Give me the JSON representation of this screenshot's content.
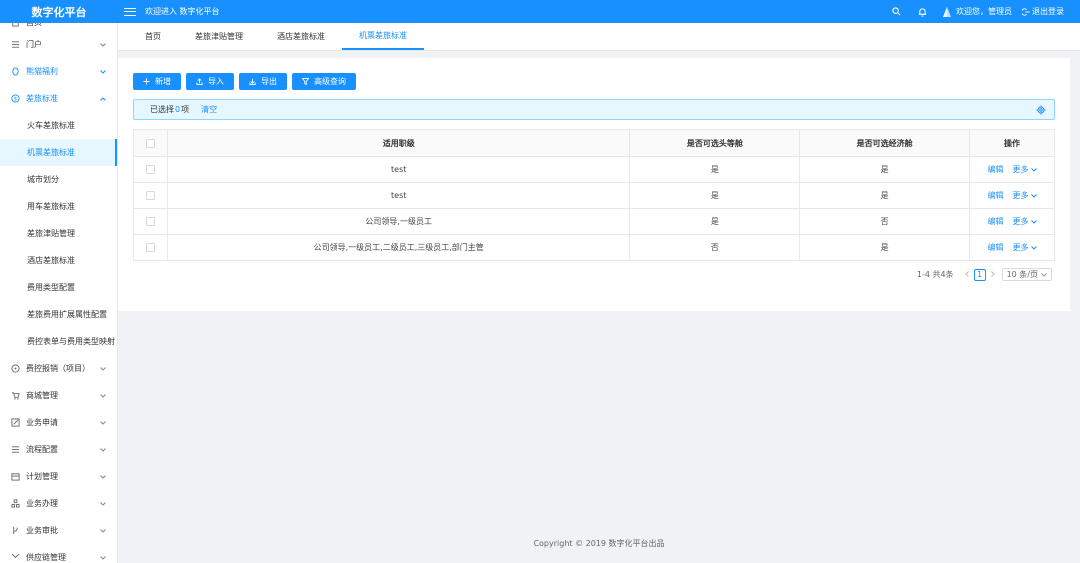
{
  "app": {
    "logo_text": "数字化平台",
    "welcome": "欢迎进入 数字化平台"
  },
  "header": {
    "greeting": "欢迎您，管理员",
    "logout": "退出登录",
    "icons": [
      "search-icon",
      "bell-icon",
      "user-avatar"
    ]
  },
  "tabs": [
    {
      "label": "首页",
      "active": false
    },
    {
      "label": "差旅津贴管理",
      "active": false
    },
    {
      "label": "酒店差旅标准",
      "active": false
    },
    {
      "label": "机票差旅标准",
      "active": true
    }
  ],
  "sidebar": {
    "items": [
      {
        "label": "首页",
        "icon": "home-icon"
      },
      {
        "label": "门户",
        "icon": "portal-icon",
        "expandable": true
      },
      {
        "label": "熊猫福利",
        "icon": "gift-icon",
        "expandable": true,
        "color": "#1890ff"
      },
      {
        "label": "差旅标准",
        "icon": "dollar-circle-icon",
        "expanded": true,
        "color": "#1890ff"
      }
    ],
    "sub_items": [
      {
        "label": "火车差旅标准"
      },
      {
        "label": "机票差旅标准",
        "selected": true
      },
      {
        "label": "城市划分"
      },
      {
        "label": "用车差旅标准"
      },
      {
        "label": "差旅津贴管理"
      },
      {
        "label": "酒店差旅标准"
      },
      {
        "label": "费用类型配置"
      },
      {
        "label": "差旅费用扩展属性配置"
      },
      {
        "label": "费控表单与费用类型映射"
      }
    ],
    "more_items": [
      {
        "label": "费控报销（项目）",
        "icon": "dollar-circle-icon"
      },
      {
        "label": "商城管理",
        "icon": "cart-icon"
      },
      {
        "label": "业务申请",
        "icon": "edit-icon"
      },
      {
        "label": "流程配置",
        "icon": "list-icon"
      },
      {
        "label": "计划管理",
        "icon": "calendar-icon"
      },
      {
        "label": "业务办理",
        "icon": "cluster-icon"
      },
      {
        "label": "业务审批",
        "icon": "branch-icon"
      },
      {
        "label": "供应链管理",
        "icon": "chain-icon"
      }
    ]
  },
  "toolbar": {
    "add": "新增",
    "import": "导入",
    "export": "导出",
    "advanced_search": "高级查询"
  },
  "selection": {
    "prefix": "已选择",
    "count": "0",
    "suffix": "项",
    "clear": "清空"
  },
  "table": {
    "columns": [
      "适用职级",
      "是否可选头等舱",
      "是否可选经济舱",
      "操作"
    ],
    "rows": [
      {
        "level": "test",
        "first_class": "是",
        "economy": "是"
      },
      {
        "level": "test",
        "first_class": "是",
        "economy": "是"
      },
      {
        "level": "公司领导,一级员工",
        "first_class": "是",
        "economy": "否"
      },
      {
        "level": "公司领导,一级员工,二级员工,三级员工,部门主管",
        "first_class": "否",
        "economy": "是"
      }
    ],
    "action_edit": "编辑",
    "action_more": "更多"
  },
  "pagination": {
    "total_text": "1-4 共4条",
    "current_page": "1",
    "page_size": "10 条/页"
  },
  "footer": {
    "copyright": "Copyright © 2019 数字化平台出品"
  },
  "colors": {
    "primary": "#1890ff",
    "background": "#f0f2f5"
  }
}
